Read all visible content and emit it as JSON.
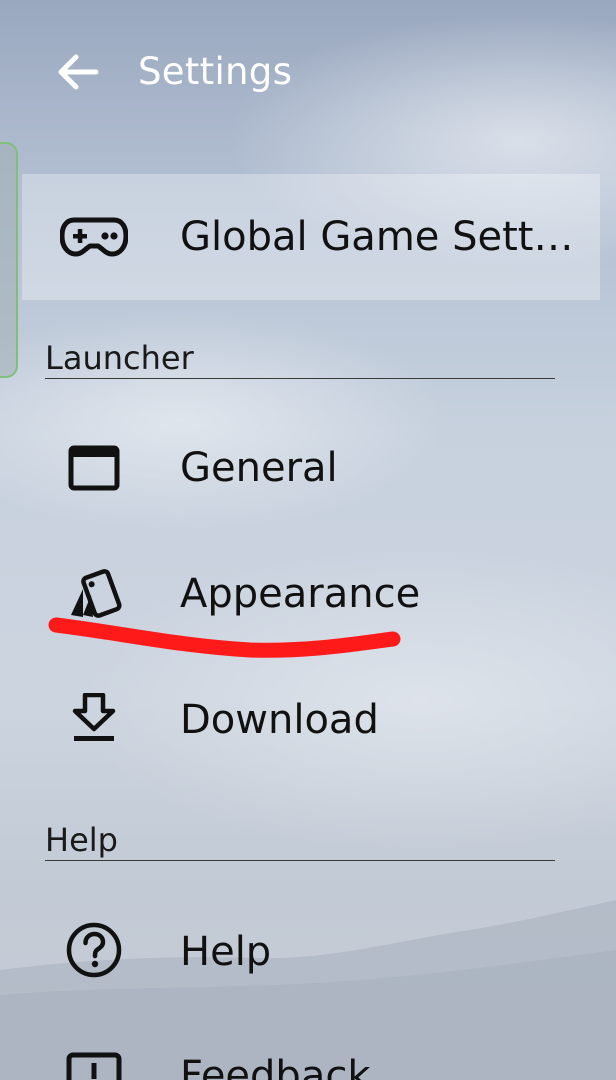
{
  "header": {
    "back_icon": "arrow-left-icon",
    "title": "Settings"
  },
  "global_game_settings": {
    "icon": "gamepad-icon",
    "label": "Global Game Setti…"
  },
  "sections": {
    "launcher": {
      "title": "Launcher",
      "items": [
        {
          "icon": "window-icon",
          "label": "General"
        },
        {
          "icon": "cards-icon",
          "label": "Appearance"
        },
        {
          "icon": "download-icon",
          "label": "Download"
        }
      ]
    },
    "help": {
      "title": "Help",
      "items": [
        {
          "icon": "help-circle-icon",
          "label": "Help"
        },
        {
          "icon": "feedback-icon",
          "label": "Feedback"
        }
      ]
    }
  },
  "colors": {
    "title_text": "#ffffff",
    "annotation": "#ff1a1a",
    "drawer_handle_border": "#7ec07a"
  }
}
